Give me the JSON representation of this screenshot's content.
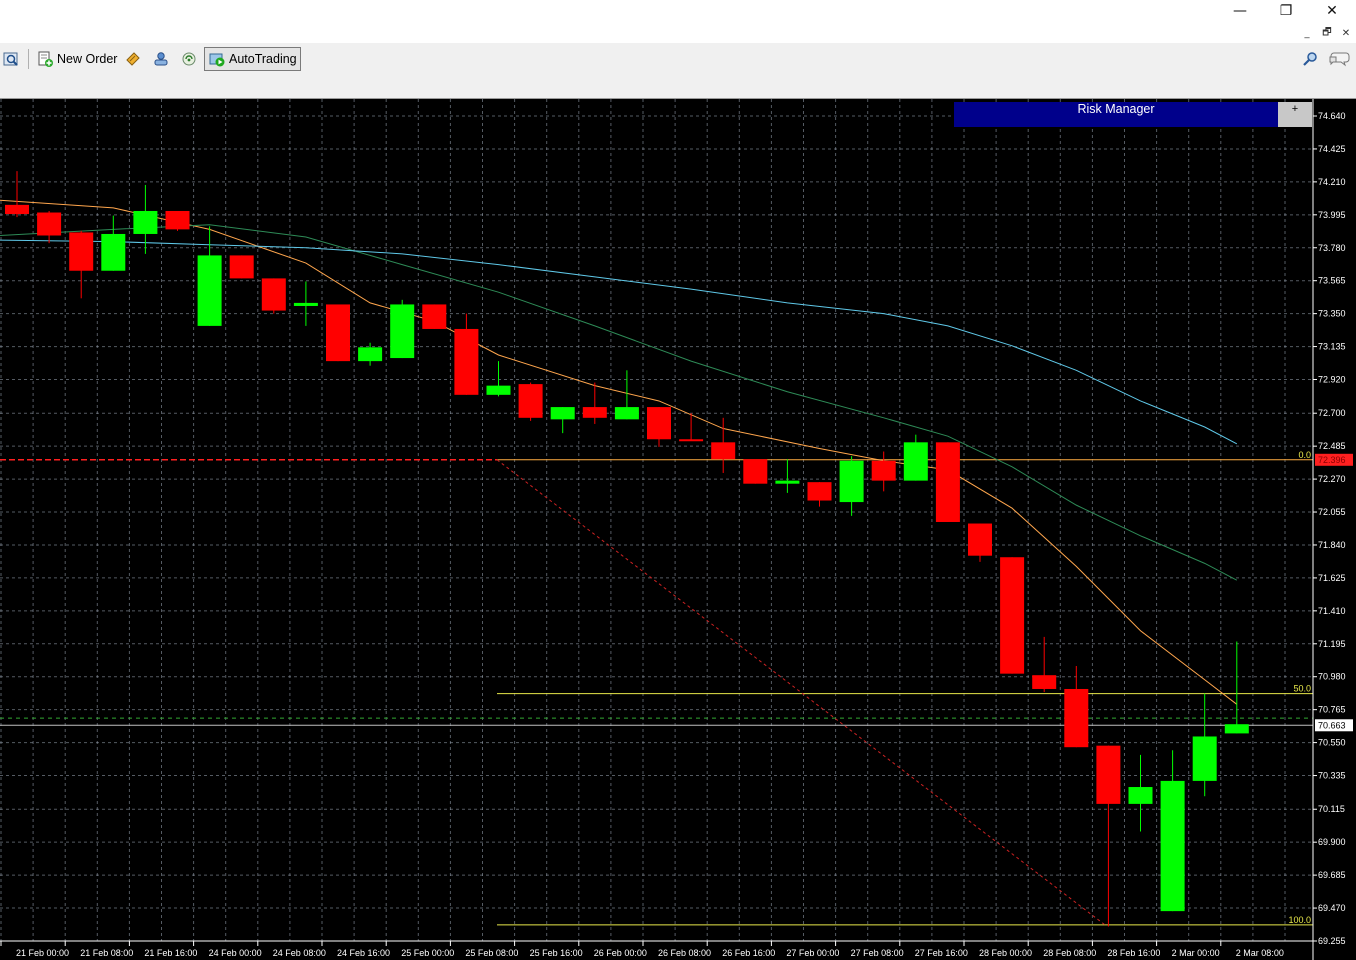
{
  "window": {
    "minimize_glyph": "—",
    "restore_glyph": "❐",
    "close_glyph": "✕",
    "mdi_minimize_glyph": "_",
    "mdi_restore_glyph": "🗗",
    "mdi_close_glyph": "✕"
  },
  "toolbar": {
    "new_order_label": "New Order",
    "autotrading_label": "AutoTrading",
    "icons": [
      "zoom-chart-icon",
      "new-order-icon",
      "metaeditor-icon",
      "navigator-icon",
      "signals-icon",
      "autotrading-icon",
      "search-icon",
      "chat-icon"
    ]
  },
  "risk_manager": {
    "title": "Risk Manager",
    "toggle": "+"
  },
  "colors": {
    "bull": "#00ff00",
    "bear": "#ff0000",
    "grid": "#9aa6b4",
    "axis_text": "#ffffff",
    "ma_fast": "#ffa64d",
    "ma_mid": "#2e8b57",
    "ma_slow": "#5fc8e8",
    "fibo": "#e8e84a",
    "hline_red": "#ff2020",
    "bid_line": "#c0c0c0"
  },
  "chart_data": {
    "type": "candlestick",
    "ylim": [
      69.255,
      74.64
    ],
    "y_ticks": [
      "74.640",
      "74.425",
      "74.210",
      "73.995",
      "73.780",
      "73.565",
      "73.350",
      "73.135",
      "72.920",
      "72.700",
      "72.485",
      "72.270",
      "72.055",
      "71.840",
      "71.625",
      "71.410",
      "71.195",
      "70.980",
      "70.765",
      "70.550",
      "70.335",
      "70.115",
      "69.900",
      "69.685",
      "69.470",
      "69.255"
    ],
    "x_labels": [
      "21 Feb 00:00",
      "21 Feb 08:00",
      "21 Feb 16:00",
      "24 Feb 00:00",
      "24 Feb 08:00",
      "24 Feb 16:00",
      "25 Feb 00:00",
      "25 Feb 08:00",
      "25 Feb 16:00",
      "26 Feb 00:00",
      "26 Feb 08:00",
      "26 Feb 16:00",
      "27 Feb 00:00",
      "27 Feb 08:00",
      "27 Feb 16:00",
      "28 Feb 00:00",
      "28 Feb 08:00",
      "28 Feb 16:00",
      "2 Mar 00:00",
      "2 Mar 08:00"
    ],
    "current_price": "70.663",
    "red_level_price": "72.396",
    "fibo_levels": [
      {
        "label": "0.0",
        "price": 72.396
      },
      {
        "label": "50.0",
        "price": 70.87
      },
      {
        "label": "100.0",
        "price": 69.36
      }
    ],
    "dashed_level": 70.71,
    "candles": [
      {
        "o": 74.06,
        "h": 74.28,
        "l": 73.98,
        "c": 74.0
      },
      {
        "o": 74.01,
        "h": 74.02,
        "l": 73.81,
        "c": 73.86
      },
      {
        "o": 73.88,
        "h": 73.89,
        "l": 73.45,
        "c": 73.63
      },
      {
        "o": 73.63,
        "h": 73.99,
        "l": 73.63,
        "c": 73.87
      },
      {
        "o": 73.87,
        "h": 74.19,
        "l": 73.74,
        "c": 74.02
      },
      {
        "o": 74.02,
        "h": 74.02,
        "l": 73.89,
        "c": 73.9
      },
      {
        "o": 73.27,
        "h": 73.92,
        "l": 73.27,
        "c": 73.73
      },
      {
        "o": 73.73,
        "h": 73.73,
        "l": 73.58,
        "c": 73.58
      },
      {
        "o": 73.58,
        "h": 73.58,
        "l": 73.35,
        "c": 73.37
      },
      {
        "o": 73.4,
        "h": 73.56,
        "l": 73.27,
        "c": 73.42
      },
      {
        "o": 73.41,
        "h": 73.41,
        "l": 73.04,
        "c": 73.04
      },
      {
        "o": 73.04,
        "h": 73.16,
        "l": 73.01,
        "c": 73.13
      },
      {
        "o": 73.06,
        "h": 73.44,
        "l": 73.06,
        "c": 73.41
      },
      {
        "o": 73.41,
        "h": 73.41,
        "l": 73.25,
        "c": 73.25
      },
      {
        "o": 73.25,
        "h": 73.35,
        "l": 72.82,
        "c": 72.82
      },
      {
        "o": 72.82,
        "h": 73.04,
        "l": 72.81,
        "c": 72.88
      },
      {
        "o": 72.89,
        "h": 72.9,
        "l": 72.65,
        "c": 72.67
      },
      {
        "o": 72.66,
        "h": 72.74,
        "l": 72.57,
        "c": 72.74
      },
      {
        "o": 72.74,
        "h": 72.9,
        "l": 72.63,
        "c": 72.67
      },
      {
        "o": 72.66,
        "h": 72.98,
        "l": 72.66,
        "c": 72.74
      },
      {
        "o": 72.74,
        "h": 72.74,
        "l": 72.48,
        "c": 72.53
      },
      {
        "o": 72.53,
        "h": 72.7,
        "l": 72.52,
        "c": 72.52
      },
      {
        "o": 72.51,
        "h": 72.67,
        "l": 72.31,
        "c": 72.4
      },
      {
        "o": 72.4,
        "h": 72.4,
        "l": 72.24,
        "c": 72.24
      },
      {
        "o": 72.24,
        "h": 72.4,
        "l": 72.18,
        "c": 72.26
      },
      {
        "o": 72.25,
        "h": 72.25,
        "l": 72.09,
        "c": 72.13
      },
      {
        "o": 72.12,
        "h": 72.42,
        "l": 72.03,
        "c": 72.39
      },
      {
        "o": 72.39,
        "h": 72.45,
        "l": 72.19,
        "c": 72.26
      },
      {
        "o": 72.26,
        "h": 72.56,
        "l": 72.26,
        "c": 72.51
      },
      {
        "o": 72.51,
        "h": 72.51,
        "l": 71.99,
        "c": 71.99
      },
      {
        "o": 71.98,
        "h": 71.98,
        "l": 71.73,
        "c": 71.77
      },
      {
        "o": 71.76,
        "h": 71.76,
        "l": 71.0,
        "c": 71.0
      },
      {
        "o": 70.99,
        "h": 71.24,
        "l": 70.88,
        "c": 70.9
      },
      {
        "o": 70.9,
        "h": 71.05,
        "l": 70.52,
        "c": 70.52
      },
      {
        "o": 70.53,
        "h": 70.53,
        "l": 69.35,
        "c": 70.15
      },
      {
        "o": 70.15,
        "h": 70.47,
        "l": 69.97,
        "c": 70.26
      },
      {
        "o": 69.45,
        "h": 70.5,
        "l": 69.45,
        "c": 70.3
      },
      {
        "o": 70.3,
        "h": 70.87,
        "l": 70.2,
        "c": 70.59
      },
      {
        "o": 70.61,
        "h": 71.21,
        "l": 70.61,
        "c": 70.67
      }
    ],
    "ma_fast": [
      [
        0,
        74.09
      ],
      [
        3,
        74.04
      ],
      [
        6,
        73.9
      ],
      [
        9,
        73.68
      ],
      [
        11,
        73.42
      ],
      [
        13,
        73.3
      ],
      [
        15,
        73.08
      ],
      [
        18,
        72.88
      ],
      [
        20,
        72.78
      ],
      [
        22,
        72.6
      ],
      [
        25,
        72.47
      ],
      [
        27,
        72.39
      ],
      [
        29,
        72.33
      ],
      [
        31,
        72.08
      ],
      [
        33,
        71.7
      ],
      [
        35,
        71.28
      ],
      [
        37,
        70.96
      ],
      [
        38,
        70.8
      ]
    ],
    "ma_mid": [
      [
        0,
        73.86
      ],
      [
        3,
        73.9
      ],
      [
        6,
        73.93
      ],
      [
        9,
        73.85
      ],
      [
        12,
        73.67
      ],
      [
        15,
        73.49
      ],
      [
        18,
        73.27
      ],
      [
        21,
        73.04
      ],
      [
        24,
        72.84
      ],
      [
        27,
        72.67
      ],
      [
        29,
        72.55
      ],
      [
        31,
        72.35
      ],
      [
        33,
        72.1
      ],
      [
        35,
        71.9
      ],
      [
        37,
        71.72
      ],
      [
        38,
        71.61
      ]
    ],
    "ma_slow": [
      [
        0,
        73.83
      ],
      [
        3,
        73.82
      ],
      [
        6,
        73.8
      ],
      [
        9,
        73.78
      ],
      [
        12,
        73.74
      ],
      [
        15,
        73.67
      ],
      [
        18,
        73.59
      ],
      [
        21,
        73.51
      ],
      [
        24,
        73.42
      ],
      [
        27,
        73.35
      ],
      [
        29,
        73.27
      ],
      [
        31,
        73.14
      ],
      [
        33,
        72.98
      ],
      [
        35,
        72.78
      ],
      [
        37,
        72.61
      ],
      [
        38,
        72.5
      ]
    ]
  }
}
